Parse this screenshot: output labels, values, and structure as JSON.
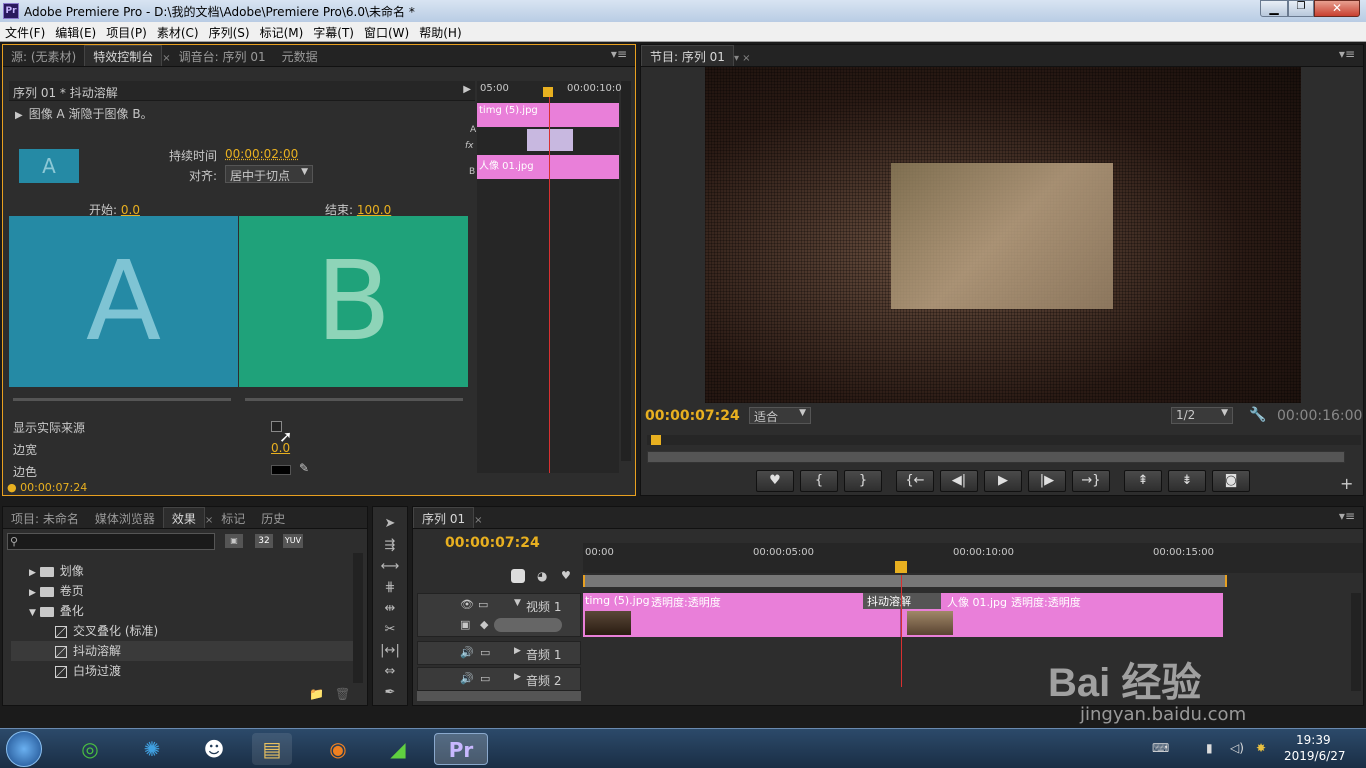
{
  "window": {
    "title": "Adobe Premiere Pro - D:\\我的文档\\Adobe\\Premiere Pro\\6.0\\未命名 *",
    "app_icon": "Pr",
    "controls": [
      "minimize-icon",
      "maximize-icon",
      "close-icon"
    ]
  },
  "menu": [
    "文件(F)",
    "编辑(E)",
    "项目(P)",
    "素材(C)",
    "序列(S)",
    "标记(M)",
    "字幕(T)",
    "窗口(W)",
    "帮助(H)"
  ],
  "source_panel": {
    "tabs": [
      "源: (无素材)",
      "特效控制台",
      "调音台: 序列 01",
      "元数据"
    ],
    "header": "序列 01 * 抖动溶解",
    "description": "图像 A 渐隐于图像 B。",
    "duration_label": "持续时间",
    "duration_value": "00:00:02:00",
    "align_label": "对齐:",
    "align_value": "居中于切点",
    "start_label": "开始:",
    "start_value": "0.0",
    "end_label": "结束:",
    "end_value": "100.0",
    "preview_a": "A",
    "preview_b": "B",
    "thumb_a": "A",
    "show_source": "显示实际来源",
    "border_width_label": "边宽",
    "border_width_value": "0.0",
    "border_color_label": "边色",
    "timecode": "00:00:07:24",
    "mini_timeline": {
      "ruler_start": "05:00",
      "ruler_end": "00:00:10:0",
      "track_a_label": "A",
      "fx_label": "fx",
      "track_b_label": "B",
      "clip_a": "timg (5).jpg",
      "clip_b": "人像 01.jpg"
    }
  },
  "program_panel": {
    "tab": "节目: 序列 01",
    "timecode": "00:00:07:24",
    "fit": "适合",
    "resolution": "1/2",
    "duration": "00:00:16:00",
    "transport": [
      "marker-icon",
      "in-point-icon",
      "out-point-icon",
      "go-to-in-icon",
      "step-back-icon",
      "play-icon",
      "step-forward-icon",
      "go-to-out-icon",
      "lift-icon",
      "extract-icon",
      "export-frame-icon"
    ]
  },
  "project_panel": {
    "tabs": [
      "项目: 未命名",
      "媒体浏览器",
      "效果",
      "标记",
      "历史"
    ],
    "search_placeholder": "",
    "tree": [
      {
        "type": "folder",
        "label": "划像",
        "expanded": false
      },
      {
        "type": "folder",
        "label": "卷页",
        "expanded": false
      },
      {
        "type": "folder",
        "label": "叠化",
        "expanded": true
      },
      {
        "type": "effect",
        "label": "交叉叠化 (标准)"
      },
      {
        "type": "effect",
        "label": "抖动溶解",
        "selected": true
      },
      {
        "type": "effect",
        "label": "白场过渡"
      }
    ],
    "badges": [
      "32",
      "YUV"
    ]
  },
  "timeline": {
    "tab": "序列 01",
    "timecode": "00:00:07:24",
    "ruler": [
      "00:00",
      "00:00:05:00",
      "00:00:10:00",
      "00:00:15:00"
    ],
    "tracks": [
      {
        "label": "视频 1"
      },
      {
        "label": "音频 1"
      },
      {
        "label": "音频 2"
      }
    ],
    "clips": [
      {
        "name": "timg (5).jpg",
        "effect": "透明度:透明度"
      },
      {
        "name": "抖动溶解",
        "type": "transition"
      },
      {
        "name": "人像 01.jpg",
        "effect": "透明度:透明度"
      }
    ]
  },
  "tools": [
    "selection-tool-icon",
    "track-select-icon",
    "ripple-edit-icon",
    "rolling-edit-icon",
    "rate-stretch-icon",
    "razor-icon",
    "slip-icon",
    "slide-icon",
    "pen-icon"
  ],
  "taskbar": {
    "time": "19:39",
    "date": "2019/6/27",
    "apps": [
      "360-icon",
      "media-icon",
      "qq-icon",
      "explorer-icon",
      "firefox-icon",
      "video-editor-icon",
      "premiere-icon"
    ]
  },
  "watermark": {
    "logo": "Bai 经验",
    "url": "jingyan.baidu.com"
  },
  "colors": {
    "accent": "#e8b020",
    "clip_pink": "#e97fd9",
    "preview_a": "#258aa5",
    "preview_b": "#1fa27a",
    "playhead": "#d83030"
  }
}
